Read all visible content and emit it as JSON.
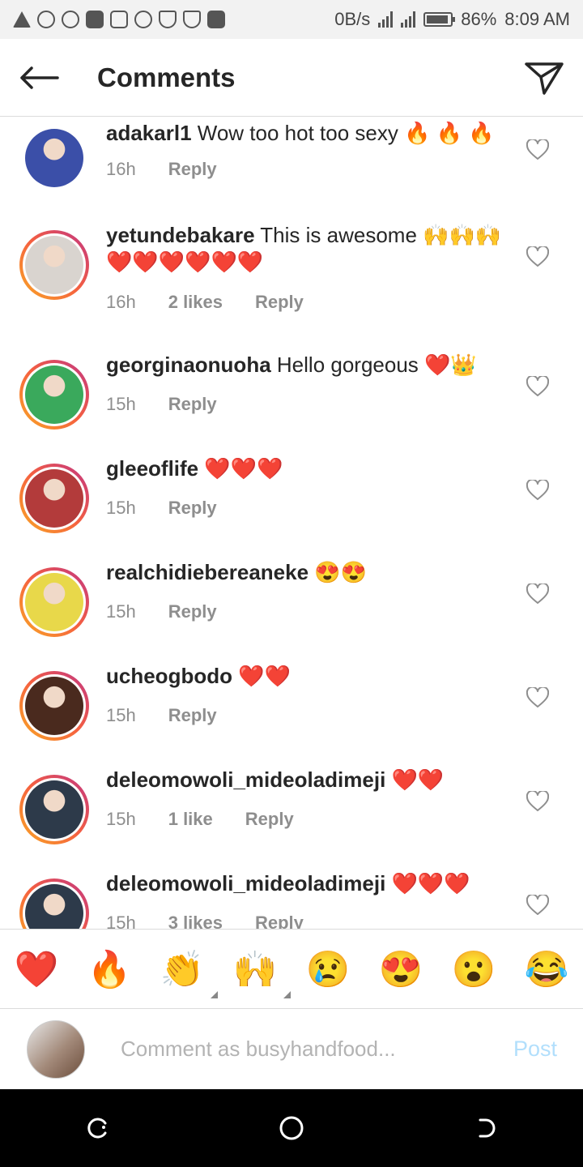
{
  "status_bar": {
    "speed": "0B/s",
    "battery": "86%",
    "time": "8:09 AM"
  },
  "header": {
    "title": "Comments"
  },
  "comments": [
    {
      "username": "adakarl1",
      "text": "Wow too hot too sexy 🔥 🔥 🔥",
      "time": "16h",
      "likes": "",
      "reply": "Reply",
      "avatar_color": "#3b4fa8",
      "ring": false
    },
    {
      "username": "yetundebakare",
      "text": "This is awesome 🙌🙌🙌❤️❤️❤️❤️❤️❤️",
      "time": "16h",
      "likes": "2 likes",
      "reply": "Reply",
      "avatar_color": "#d9d4cf",
      "ring": true
    },
    {
      "username": "georginaonuoha",
      "text": "Hello gorgeous ❤️👑",
      "time": "15h",
      "likes": "",
      "reply": "Reply",
      "avatar_color": "#3aa95c",
      "ring": true
    },
    {
      "username": "gleeoflife",
      "text": "❤️❤️❤️",
      "time": "15h",
      "likes": "",
      "reply": "Reply",
      "avatar_color": "#b33b3b",
      "ring": true
    },
    {
      "username": "realchidiebereaneke",
      "text": "😍😍",
      "time": "15h",
      "likes": "",
      "reply": "Reply",
      "avatar_color": "#e8d84a",
      "ring": true
    },
    {
      "username": "ucheogbodo",
      "text": "❤️❤️",
      "time": "15h",
      "likes": "",
      "reply": "Reply",
      "avatar_color": "#4a2a1e",
      "ring": true
    },
    {
      "username": "deleomowoli_mideoladimeji",
      "text": "❤️❤️",
      "time": "15h",
      "likes": "1 like",
      "reply": "Reply",
      "avatar_color": "#2d3a4a",
      "ring": true
    },
    {
      "username": "deleomowoli_mideoladimeji",
      "text": "❤️❤️❤️",
      "time": "15h",
      "likes": "3 likes",
      "reply": "Reply",
      "avatar_color": "#2d3a4a",
      "ring": true
    }
  ],
  "reactions": [
    "❤️",
    "🔥",
    "👏",
    "🙌",
    "😢",
    "😍",
    "😮",
    "😂"
  ],
  "composer": {
    "placeholder": "Comment as busyhandfood...",
    "post_label": "Post"
  }
}
